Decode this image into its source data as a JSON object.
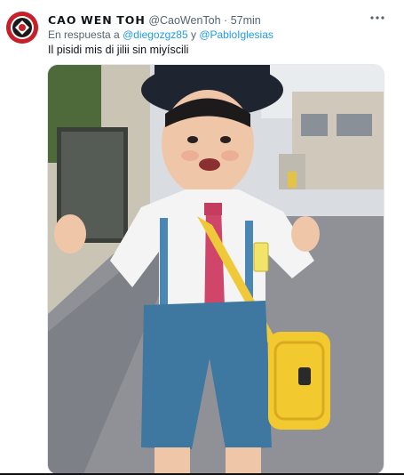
{
  "tweet": {
    "display_name": "𝗖𝗔𝗢 𝗪𝗘𝗡 𝗧𝗢𝗛",
    "handle": "@CaoWenToh",
    "separator": "·",
    "time": "57min",
    "more_icon": "more-icon",
    "reply_prefix": "En respuesta a ",
    "reply_user1": "@diegozgz85",
    "reply_and": " y ",
    "reply_user2": "@PabloIglesias",
    "text": "Il pisidi mis di jilii sin miyíscili"
  },
  "colors": {
    "link": "#1d9bf0",
    "muted": "#536471",
    "avatar_bg": "#c8202a"
  }
}
